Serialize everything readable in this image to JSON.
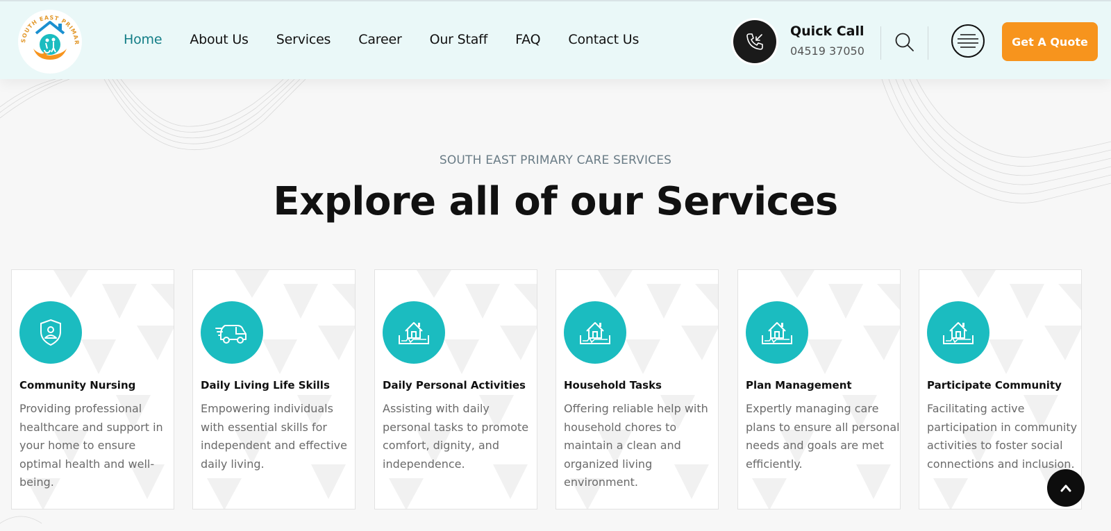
{
  "header": {
    "logo_text": "SOUTH EAST PRIMARY CARE PTY LTD",
    "nav": [
      {
        "label": "Home",
        "active": true
      },
      {
        "label": "About Us",
        "active": false
      },
      {
        "label": "Services",
        "active": false
      },
      {
        "label": "Career",
        "active": false
      },
      {
        "label": "Our Staff",
        "active": false
      },
      {
        "label": "FAQ",
        "active": false
      },
      {
        "label": "Contact Us",
        "active": false
      }
    ],
    "call_title": "Quick Call",
    "call_number": "04519 37050",
    "quote_label": "Get A Quote",
    "icons": {
      "call": "phone-incoming-icon",
      "search": "search-icon",
      "menu": "hamburger-menu-icon",
      "scroll_top": "chevron-up-icon"
    }
  },
  "section": {
    "eyebrow": "SOUTH EAST PRIMARY CARE SERVICES",
    "title": "Explore all of our Services"
  },
  "services": [
    {
      "title": "Community Nursing",
      "text": "Providing professional healthcare and support in your home to ensure optimal health and well-being.",
      "icon": "shield-user-icon"
    },
    {
      "title": "Daily Living Life Skills",
      "text": "Empowering individuals with essential skills for independent and effective daily living.",
      "icon": "delivery-van-icon"
    },
    {
      "title": "Daily Personal Activities",
      "text": "Assisting with daily personal tasks to promote comfort, dignity, and independence.",
      "icon": "house-icon"
    },
    {
      "title": "Household Tasks",
      "text": "Offering reliable help with household chores to maintain a clean and organized living environment.",
      "icon": "house-icon"
    },
    {
      "title": "Plan Management",
      "text": "Expertly managing care plans to ensure all personal needs and goals are met efficiently.",
      "icon": "house-icon"
    },
    {
      "title": "Participate Community",
      "text": "Facilitating active participation in community activities to foster social connections and inclusion.",
      "icon": "house-icon"
    }
  ],
  "colors": {
    "header_bg": "#eaf8f8",
    "nav_active": "#127d86",
    "accent_teal": "#1bbcc0",
    "quote_orange": "#f7941d",
    "page_bg": "#f7f7f7"
  }
}
